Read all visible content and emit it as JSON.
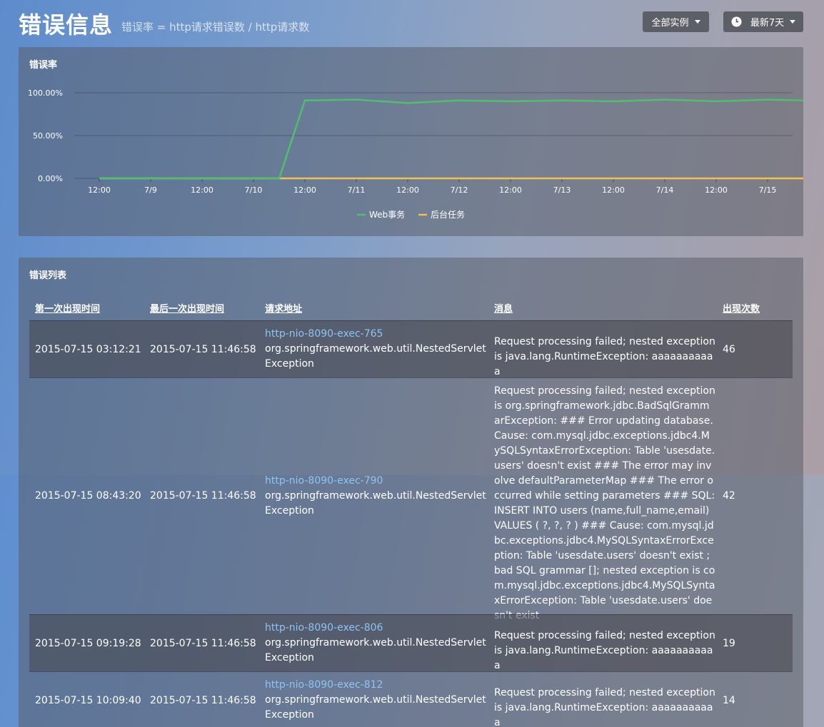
{
  "header": {
    "title": "错误信息",
    "subtitle": "错误率 = http请求错误数 / http请求数",
    "instances_label": "全部实例",
    "range_label": "最新7天"
  },
  "error_rate": {
    "panel_title": "错误率",
    "chart_data": {
      "type": "line",
      "title": "错误率",
      "x": [
        "7/8 12:00",
        "7/9 00:00",
        "7/9 12:00",
        "7/10 00:00",
        "7/10 12:00",
        "7/11 00:00",
        "7/11 12:00",
        "7/12 00:00",
        "7/12 12:00",
        "7/13 00:00",
        "7/13 12:00",
        "7/14 00:00",
        "7/14 12:00",
        "7/15 00:00"
      ],
      "x_tick_labels": [
        "12:00",
        "7/9",
        "12:00",
        "7/10",
        "12:00",
        "7/11",
        "12:00",
        "7/12",
        "12:00",
        "7/13",
        "12:00",
        "7/14",
        "12:00",
        "7/15"
      ],
      "y_tick_labels": [
        "100.00%",
        "50.00%",
        "0.00%"
      ],
      "ylim": [
        0,
        100
      ],
      "grid": true,
      "legend_position": "bottom",
      "series": [
        {
          "name": "Web事务",
          "color": "#4fbf6c",
          "points": [
            {
              "t": 7.75,
              "v": 0
            },
            {
              "t": 8.25,
              "v": 0
            },
            {
              "t": 8.75,
              "v": 0
            },
            {
              "t": 9.25,
              "v": 0
            },
            {
              "t": 9.5,
              "v": 0
            },
            {
              "t": 9.75,
              "v": 91
            },
            {
              "t": 10.25,
              "v": 92
            },
            {
              "t": 10.75,
              "v": 88
            },
            {
              "t": 11.25,
              "v": 91
            },
            {
              "t": 11.75,
              "v": 90
            },
            {
              "t": 12.25,
              "v": 91
            },
            {
              "t": 12.75,
              "v": 90
            },
            {
              "t": 13.25,
              "v": 92
            },
            {
              "t": 13.75,
              "v": 90
            },
            {
              "t": 14.25,
              "v": 92
            },
            {
              "t": 14.62,
              "v": 91
            }
          ]
        },
        {
          "name": "后台任务",
          "color": "#f0c24f",
          "points": [
            {
              "t": 7.75,
              "v": 0
            },
            {
              "t": 14.62,
              "v": 0
            }
          ]
        }
      ]
    }
  },
  "error_list": {
    "panel_title": "错误列表",
    "columns": [
      "第一次出现时间",
      "最后一次出现时间",
      "请求地址",
      "消息",
      "出现次数"
    ],
    "rows": [
      {
        "first": "2015-07-15 03:12:21",
        "last": "2015-07-15 11:46:58",
        "url": "http-nio-8090-exec-765",
        "exception": "org.springframework.web.util.NestedServletException",
        "message": "Request processing failed; nested exception is java.lang.RuntimeException: aaaaaaaaaaa",
        "count": "46"
      },
      {
        "first": "2015-07-15 08:43:20",
        "last": "2015-07-15 11:46:58",
        "url": "http-nio-8090-exec-790",
        "exception": "org.springframework.web.util.NestedServletException",
        "message": "Request processing failed; nested exception is org.springframework.jdbc.BadSqlGrammarException: ### Error updating database. Cause: com.mysql.jdbc.exceptions.jdbc4.MySQLSyntaxErrorException: Table 'usesdate.users' doesn't exist ### The error may involve defaultParameterMap ### The error occurred while setting parameters ### SQL: INSERT INTO users (name,full_name,email) VALUES ( ?, ?, ? ) ### Cause: com.mysql.jdbc.exceptions.jdbc4.MySQLSyntaxErrorException: Table 'usesdate.users' doesn't exist ; bad SQL grammar []; nested exception is com.mysql.jdbc.exceptions.jdbc4.MySQLSyntaxErrorException: Table 'usesdate.users' doesn't exist",
        "count": "42"
      },
      {
        "first": "2015-07-15 09:19:28",
        "last": "2015-07-15 11:46:58",
        "url": "http-nio-8090-exec-806",
        "exception": "org.springframework.web.util.NestedServletException",
        "message": "Request processing failed; nested exception is java.lang.RuntimeException: aaaaaaaaaaa",
        "count": "19"
      },
      {
        "first": "2015-07-15 10:09:40",
        "last": "2015-07-15 11:46:58",
        "url": "http-nio-8090-exec-812",
        "exception": "org.springframework.web.util.NestedServletException",
        "message": "Request processing failed; nested exception is java.lang.RuntimeException: aaaaaaaaaaa",
        "count": "14"
      }
    ]
  }
}
